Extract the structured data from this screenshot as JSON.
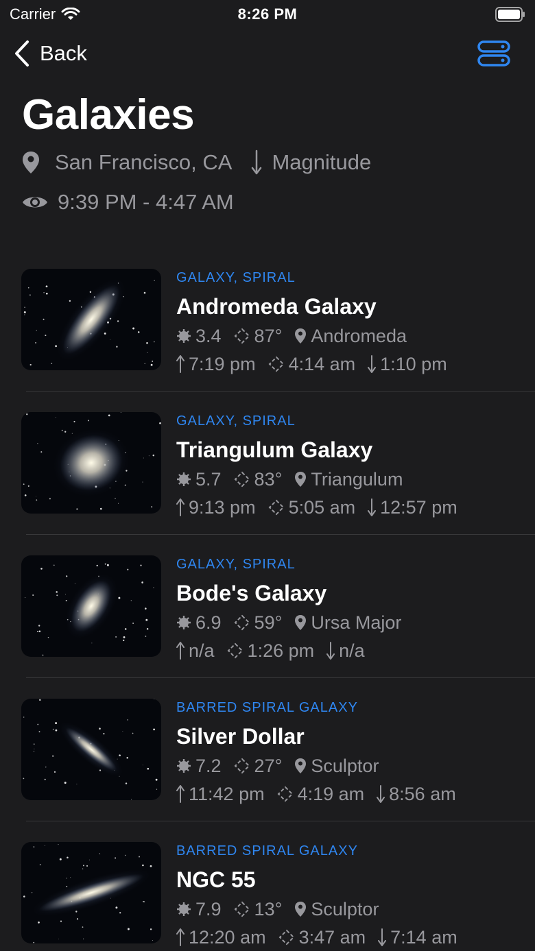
{
  "status_bar": {
    "carrier": "Carrier",
    "time": "8:26 PM"
  },
  "nav": {
    "back_label": "Back",
    "accent": "#2f86f0"
  },
  "header": {
    "title": "Galaxies",
    "location": "San Francisco, CA",
    "sort": "Magnitude",
    "visibility_window": "9:39 PM - 4:47 AM"
  },
  "objects": [
    {
      "category": "GALAXY, SPIRAL",
      "name": "Andromeda Galaxy",
      "magnitude": "3.4",
      "altitude": "87°",
      "constellation": "Andromeda",
      "rise": "7:19 pm",
      "transit": "4:14 am",
      "set": "1:10 pm"
    },
    {
      "category": "GALAXY, SPIRAL",
      "name": "Triangulum Galaxy",
      "magnitude": "5.7",
      "altitude": "83°",
      "constellation": "Triangulum",
      "rise": "9:13 pm",
      "transit": "5:05 am",
      "set": "12:57 pm"
    },
    {
      "category": "GALAXY, SPIRAL",
      "name": "Bode's Galaxy",
      "magnitude": "6.9",
      "altitude": "59°",
      "constellation": "Ursa Major",
      "rise": "n/a",
      "transit": "1:26 pm",
      "set": "n/a"
    },
    {
      "category": "BARRED SPIRAL GALAXY",
      "name": "Silver Dollar",
      "magnitude": "7.2",
      "altitude": "27°",
      "constellation": "Sculptor",
      "rise": "11:42 pm",
      "transit": "4:19 am",
      "set": "8:56 am"
    },
    {
      "category": "BARRED SPIRAL GALAXY",
      "name": "NGC 55",
      "magnitude": "7.9",
      "altitude": "13°",
      "constellation": "Sculptor",
      "rise": "12:20 am",
      "transit": "3:47 am",
      "set": "7:14 am"
    }
  ],
  "icons": {
    "magnitude": "sun-icon",
    "altitude": "altitude-diamond-icon",
    "constellation": "location-pin-icon",
    "rise": "arrow-up-icon",
    "transit": "transit-diamond-icon",
    "set": "arrow-down-icon"
  }
}
